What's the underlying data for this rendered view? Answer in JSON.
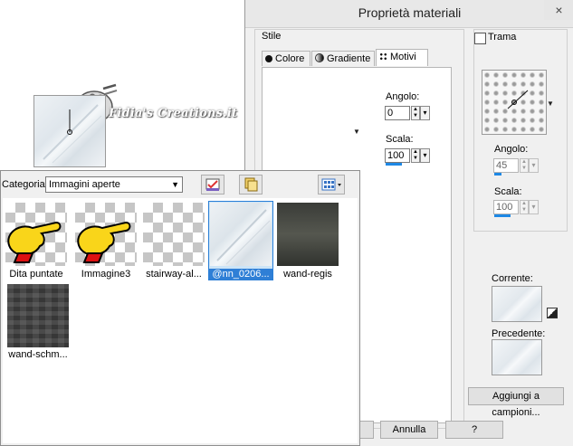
{
  "watermark": {
    "text": "Fidia's Creations.it",
    "icon": "palette-icon"
  },
  "materials": {
    "title": "Proprietà materiali",
    "close_label": "×",
    "stile_label": "Stile",
    "tabs": [
      {
        "label": "Colore",
        "icon": "circle-icon"
      },
      {
        "label": "Gradiente",
        "icon": "gradient-icon"
      },
      {
        "label": "Motivi",
        "icon": "pattern-icon"
      }
    ],
    "left": {
      "angolo_label": "Angolo:",
      "angolo_value": "0",
      "scala_label": "Scala:",
      "scala_value": "100"
    },
    "trama": {
      "label": "Trama",
      "checked": false,
      "angolo_label": "Angolo:",
      "angolo_value": "45",
      "scala_label": "Scala:",
      "scala_value": "100"
    },
    "corrente_label": "Corrente:",
    "precedente_label": "Precedente:",
    "aggiungi_label": "Aggiungi a campioni...",
    "annulla_label": "Annulla",
    "help_label": "?"
  },
  "images": {
    "category_label": "Categoria:",
    "category_value": "Immagini aperte",
    "thumbnails": [
      {
        "label": "Dita puntate"
      },
      {
        "label": "Immagine3"
      },
      {
        "label": "stairway-al..."
      },
      {
        "label": "@nn_0206..."
      },
      {
        "label": "wand-regis"
      },
      {
        "label": "wand-schm..."
      }
    ]
  },
  "colors": {
    "accent": "#2f7fd6",
    "dialog_bg": "#f0f0f0"
  }
}
